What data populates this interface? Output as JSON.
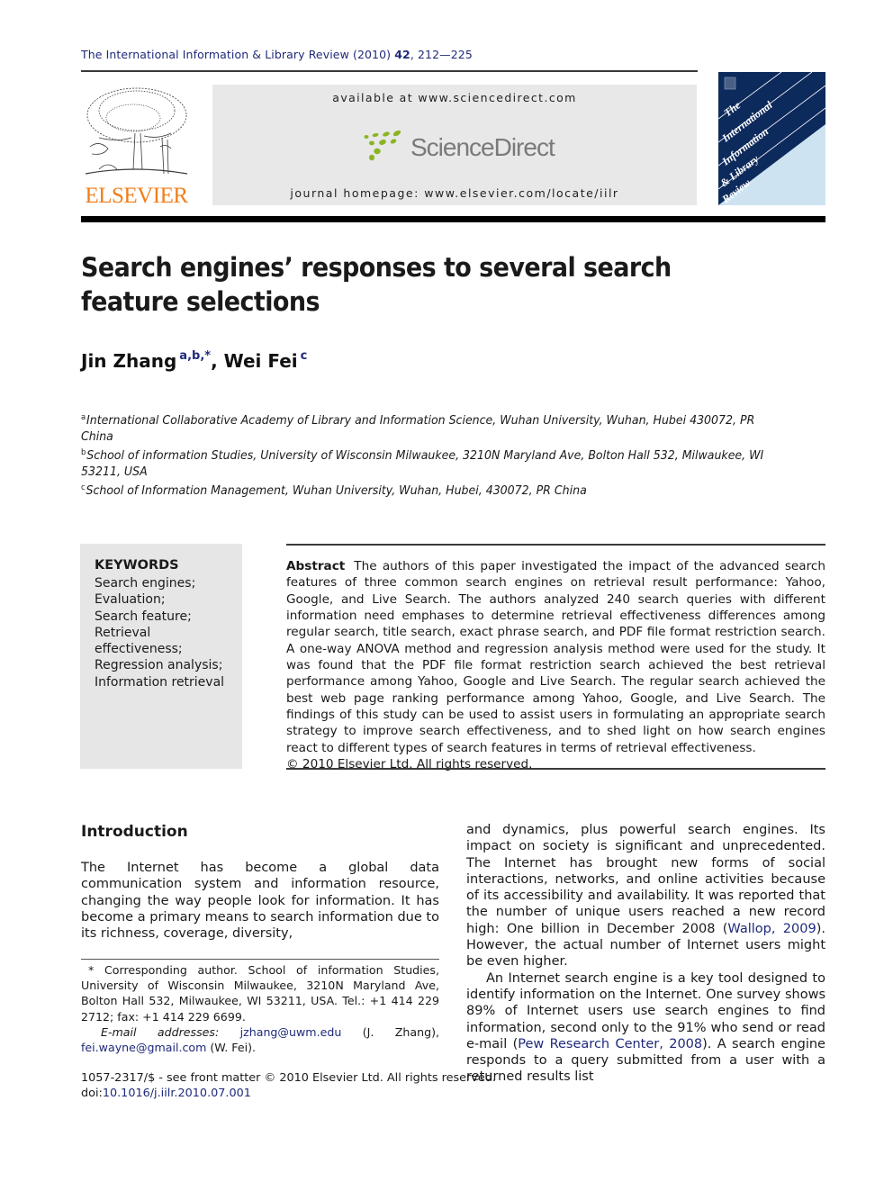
{
  "header": {
    "journal_name": "The International Information & Library Review (2010)",
    "volume": "42",
    "pages": ", 212—225",
    "publisher_logo_text": "ELSEVIER",
    "available_at": "available at www.sciencedirect.com",
    "sciencedirect_logo_text": "ScienceDirect",
    "journal_homepage": "journal homepage: www.elsevier.com/locate/iilr",
    "cover_title_lines": [
      "The",
      "International",
      "Information",
      "& Library",
      "Review"
    ],
    "colors": {
      "accent_link": "#1f2a7a",
      "elsevier_orange": "#f07e1a",
      "cover_navy": "#0d2a5c",
      "cover_light": "#cde3f2",
      "sd_green": "#8ab523"
    }
  },
  "article": {
    "title": "Search engines’ responses to several search feature selections",
    "authors": [
      {
        "name": "Jin Zhang",
        "marks": "a,b,*"
      },
      {
        "name": "Wei Fei",
        "marks": "c"
      }
    ],
    "author_separator": ", ",
    "affiliations": [
      {
        "mark": "a",
        "text": "International Collaborative Academy of Library and Information Science, Wuhan University, Wuhan, Hubei 430072, PR China"
      },
      {
        "mark": "b",
        "text": "School of information Studies, University of Wisconsin Milwaukee, 3210N Maryland Ave, Bolton Hall 532, Milwaukee, WI 53211, USA"
      },
      {
        "mark": "c",
        "text": "School of Information Management, Wuhan University, Wuhan, Hubei, 430072, PR China"
      }
    ]
  },
  "keywords": {
    "heading": "KEYWORDS",
    "items": [
      "Search engines;",
      "Evaluation;",
      "Search feature;",
      "Retrieval effectiveness;",
      "Regression analysis;",
      "Information retrieval"
    ]
  },
  "abstract": {
    "label": "Abstract",
    "text": "The authors of this paper investigated the impact of the advanced search features of three common search engines on retrieval result performance: Yahoo, Google, and Live Search. The authors analyzed 240 search queries with different information need emphases to determine retrieval effectiveness differences among regular search, title search, exact phrase search, and PDF file format restriction search. A one-way ANOVA method and regression analysis method were used for the study. It was found that the PDF file format restriction search achieved the best retrieval performance among Yahoo, Google and Live Search. The regular search achieved the best web page ranking performance among Yahoo, Google, and Live Search. The findings of this study can be used to assist users in formulating an appropriate search strategy to improve search effectiveness, and to shed light on how search engines react to different types of search features in terms of retrieval effectiveness.",
    "copyright": "© 2010 Elsevier Ltd. All rights reserved."
  },
  "introduction": {
    "heading": "Introduction",
    "para1_left": "The Internet has become a global data communication system and information resource, changing the way people look for information. It has become a primary means to search information due to its richness, coverage, diversity,",
    "para1_right_before": "and dynamics, plus powerful search engines. Its impact on society is significant and unprecedented. The Internet has brought new forms of social interactions, networks, and online activities because of its accessibility and availability. It was reported that the number of unique users reached a new record high: One billion in December 2008 (",
    "cite1": "Wallop, 2009",
    "para1_right_after": "). However, the actual number of Internet users might be even higher.",
    "para2_before": "An Internet search engine is a key tool designed to identify information on the Internet. One survey shows 89% of Internet users use search engines to find information, second only to the 91% who send or read e-mail (",
    "cite2": "Pew Research Center, 2008",
    "para2_after": "). A search engine responds to a query submitted from a user with a returned results list"
  },
  "footnote": {
    "corresponding": "* Corresponding author. School of information Studies, University of Wisconsin Milwaukee, 3210N Maryland Ave, Bolton Hall 532, Milwaukee, WI 53211, USA. Tel.: +1 414 229 2712; fax: +1 414 229 6699.",
    "email_label": "E-mail addresses:",
    "email1": "jzhang@uwm.edu",
    "email1_owner": " (J. Zhang), ",
    "email2": "fei.wayne@gmail.com",
    "email2_owner": " (W. Fei)."
  },
  "front_matter": {
    "issn_line": "1057-2317/$ - see front matter © 2010 Elsevier Ltd. All rights reserved.",
    "doi_label": "doi:",
    "doi": "10.1016/j.iilr.2010.07.001"
  }
}
